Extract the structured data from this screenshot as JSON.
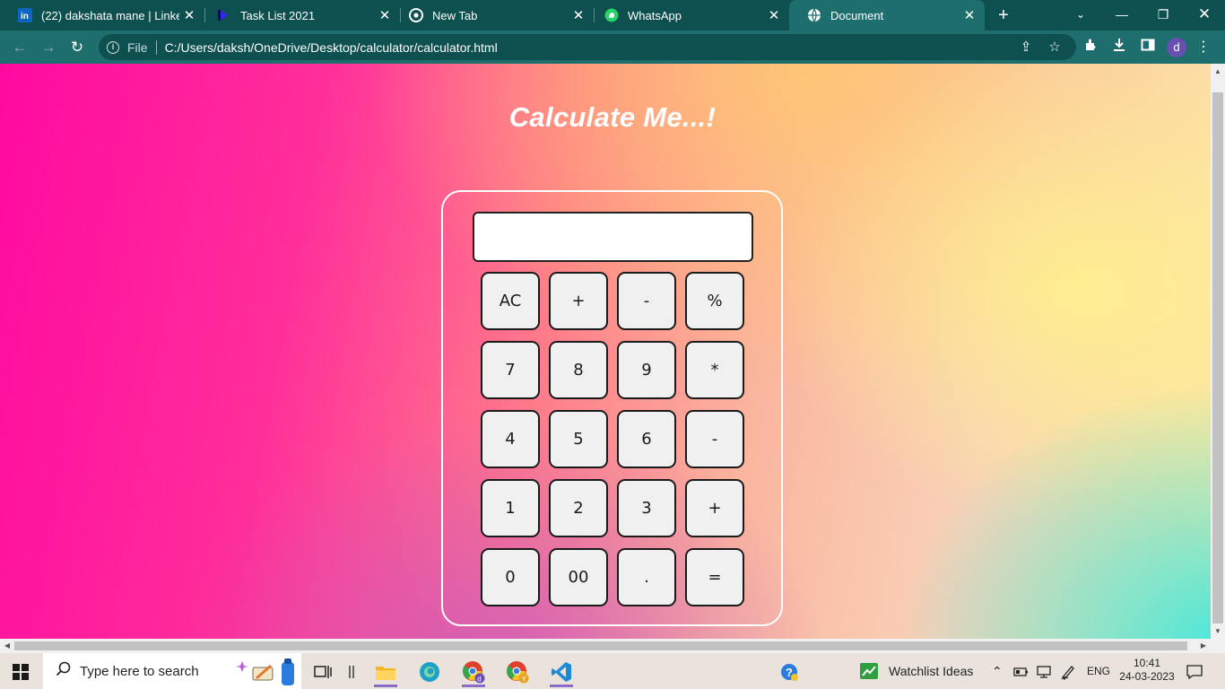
{
  "browser": {
    "tabs": [
      {
        "title": "(22) dakshata mane | LinkedIn",
        "favicon": "linkedin-icon",
        "active": false
      },
      {
        "title": "Task List 2021",
        "favicon": "tasklist-icon",
        "active": false
      },
      {
        "title": "New Tab",
        "favicon": "chrome-icon",
        "active": false
      },
      {
        "title": "WhatsApp",
        "favicon": "whatsapp-icon",
        "active": false
      },
      {
        "title": "Document",
        "favicon": "globe-icon",
        "active": true
      }
    ],
    "address": {
      "scheme_label": "File",
      "url": "C:/Users/daksh/OneDrive/Desktop/calculator/calculator.html"
    },
    "profile_initial": "d",
    "theme_color": "#1e6e6e"
  },
  "page": {
    "heading": "Calculate Me...!",
    "display_value": "",
    "keys": [
      [
        "AC",
        "+",
        "-",
        "%"
      ],
      [
        "7",
        "8",
        "9",
        "*"
      ],
      [
        "4",
        "5",
        "6",
        "-"
      ],
      [
        "1",
        "2",
        "3",
        "+"
      ],
      [
        "0",
        "00",
        ".",
        "="
      ]
    ]
  },
  "taskbar": {
    "search_placeholder": "Type here to search",
    "widget_label": "Watchlist Ideas",
    "language": "ENG",
    "time": "10:41",
    "date": "24-03-2023"
  }
}
